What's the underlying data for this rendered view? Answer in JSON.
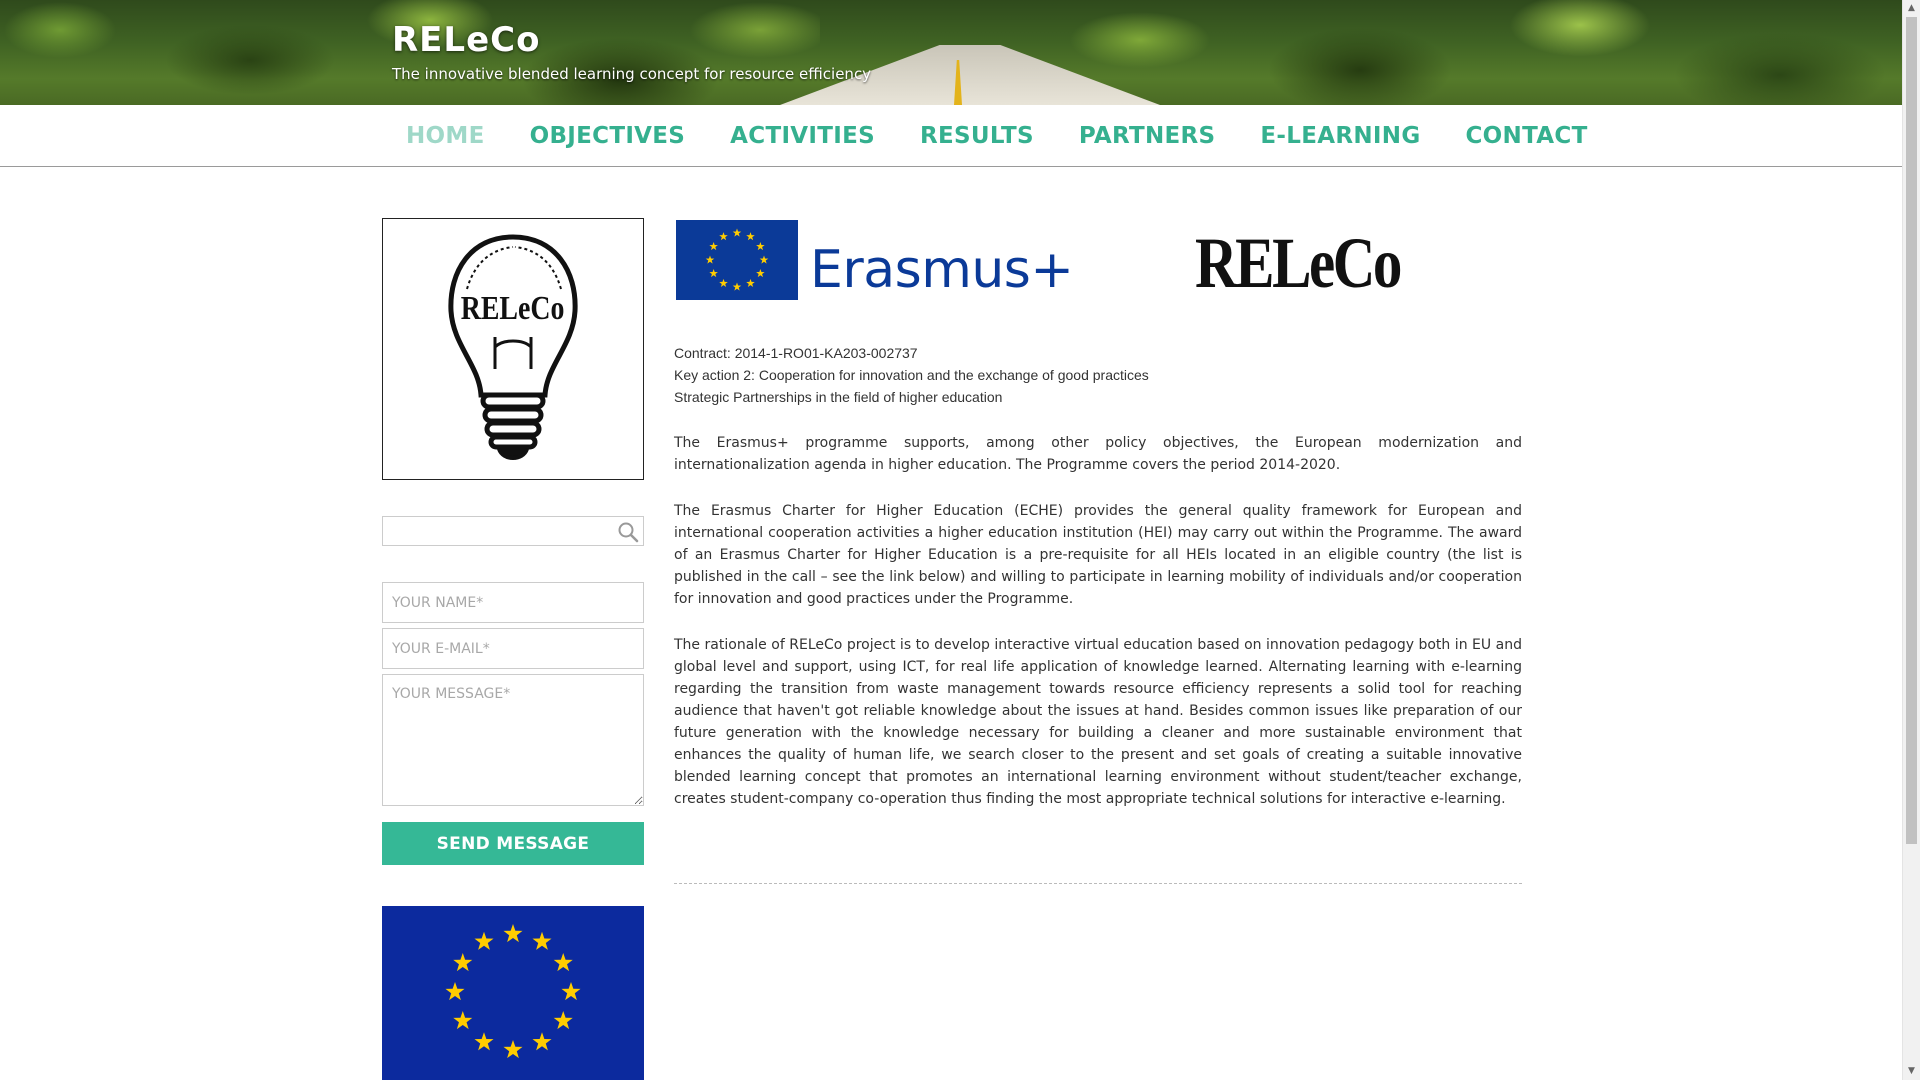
{
  "site": {
    "title": "RELeCo",
    "tagline": "The innovative blended learning concept for resource efficiency"
  },
  "nav": {
    "items": [
      {
        "label": "HOME",
        "active": true
      },
      {
        "label": "OBJECTIVES"
      },
      {
        "label": "ACTIVITIES"
      },
      {
        "label": "RESULTS"
      },
      {
        "label": "PARTNERS"
      },
      {
        "label": "E-LEARNING"
      },
      {
        "label": "CONTACT"
      }
    ]
  },
  "sidebar": {
    "logo_text": "RELeCo",
    "search": {
      "placeholder": "",
      "icon": "search-icon"
    },
    "contact_form": {
      "name_placeholder": "YOUR NAME*",
      "email_placeholder": "YOUR E-MAIL*",
      "message_placeholder": "YOUR MESSAGE*",
      "send_label": "SEND MESSAGE"
    }
  },
  "main": {
    "erasmus_logo_text": "Erasmus+",
    "releco_logo_text": "RELeCo",
    "meta": [
      "Contract: 2014-1-RO01-KA203-002737",
      "Key action 2: Cooperation for innovation and the exchange of good practices",
      "Strategic Partnerships in the field of higher education"
    ],
    "paragraphs": [
      "The Erasmus+ programme supports, among other policy objectives, the European modernization and internationalization agenda in higher education. The Programme covers the period 2014-2020.",
      "The Erasmus Charter for Higher Education (ECHE) provides the general quality framework for European and international cooperation activities a higher education institution (HEI) may carry out within the Programme. The award of an Erasmus Charter for Higher Education is a pre-requisite for all HEIs located in an eligible country (the list is published in the call – see the link below) and willing to participate in learning mobility of individuals and/or cooperation for innovation and good practices under the Programme.",
      "The rationale of RELeCo project is to develop interactive virtual education based on innovation pedagogy both in EU and global level and support, using ICT, for real life application of knowledge learned. Alternating learning with e-learning regarding the transition from waste management towards resource efficiency represents a solid tool for reaching audience that haven't got reliable knowledge about the issues at hand. Besides common issues like preparation of our future generation with the knowledge necessary for building a cleaner and more sustainable environment that enhances the quality of human life, we search closer to the present and set goals of creating a suitable innovative blended learning concept that promotes an international learning environment without student/teacher exchange, creates student-company co-operation thus finding the most appropriate technical solutions for interactive e-learning."
    ]
  },
  "colors": {
    "accent": "#35b896",
    "nav_text": "#35b08f",
    "nav_active": "#9fd8c8",
    "eu_blue": "#0c2a9e",
    "eu_star": "#ffcc00",
    "erasmus_blue": "#0b3a98"
  }
}
